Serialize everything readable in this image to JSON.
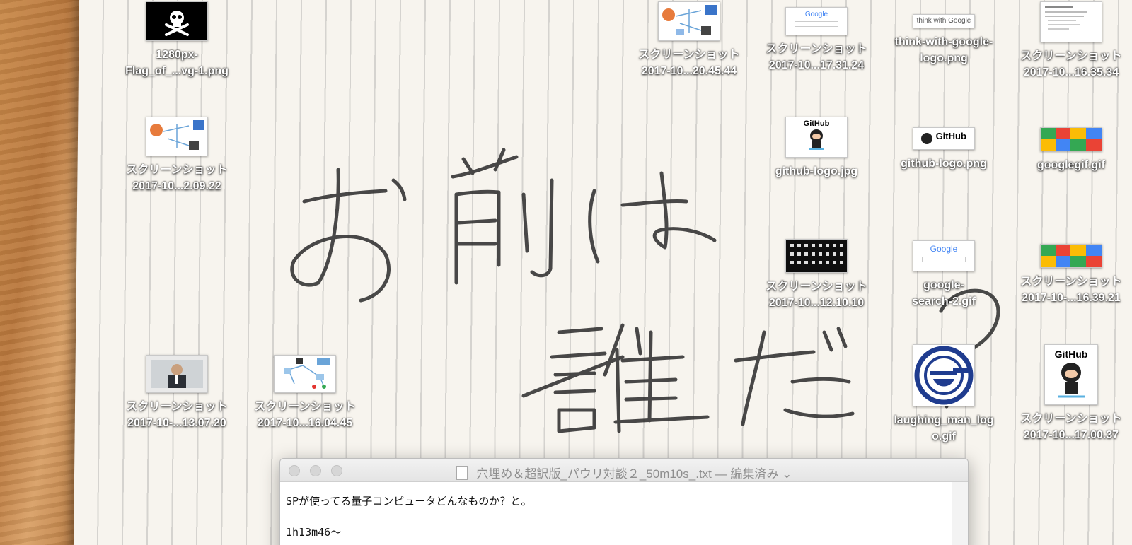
{
  "desktop": {
    "icons": [
      {
        "id": "flag",
        "label": "1280px-\nFlag_of_...vg-1.png"
      },
      {
        "id": "ss1",
        "label": "スクリーンショット\n2017-10...20.45.44"
      },
      {
        "id": "ss2",
        "label": "スクリーンショット\n2017-10...17.31.24"
      },
      {
        "id": "thinkgoogle",
        "label": "think-with-google-\nlogo.png",
        "thumb_text": "think with Google"
      },
      {
        "id": "ss3",
        "label": "スクリーンショット\n2017-10...16.35.34"
      },
      {
        "id": "ss4",
        "label": "スクリーンショット\n2017-10...2.09.22"
      },
      {
        "id": "ghjpg",
        "label": "github-logo.jpg",
        "thumb_text": "GitHub"
      },
      {
        "id": "ghpng",
        "label": "github-logo.png",
        "thumb_text": "GitHub"
      },
      {
        "id": "googlegif",
        "label": "googlegif.gif"
      },
      {
        "id": "ss5",
        "label": "スクリーンショット\n2017-10...12.10.10"
      },
      {
        "id": "gsearch",
        "label": "google-\nsearch-2.gif",
        "thumb_text": "Google"
      },
      {
        "id": "ss6",
        "label": "スクリーンショット\n2017-10-...16.39.21"
      },
      {
        "id": "ss7",
        "label": "スクリーンショット\n2017-10-...13.07.20"
      },
      {
        "id": "ss8",
        "label": "スクリーンショット\n2017-10...16.04.45"
      },
      {
        "id": "laughing",
        "label": "laughing_man_log\no.gif"
      },
      {
        "id": "ss9",
        "label": "スクリーンショット\n2017-10...17.00.37",
        "thumb_text": "GitHub"
      }
    ],
    "google_text": "Google"
  },
  "textedit": {
    "title": "穴埋め＆超訳版_パウリ対談２_50m10s_.txt",
    "edited": "— 編集済み",
    "lines": [
      "SPが使ってる量子コンピュータどんなものか？と。",
      "1h13m46〜"
    ]
  },
  "colors": {
    "google_blue": "#4285F4",
    "google_red": "#EA4335",
    "google_yellow": "#FBBC05",
    "google_green": "#34A853"
  }
}
